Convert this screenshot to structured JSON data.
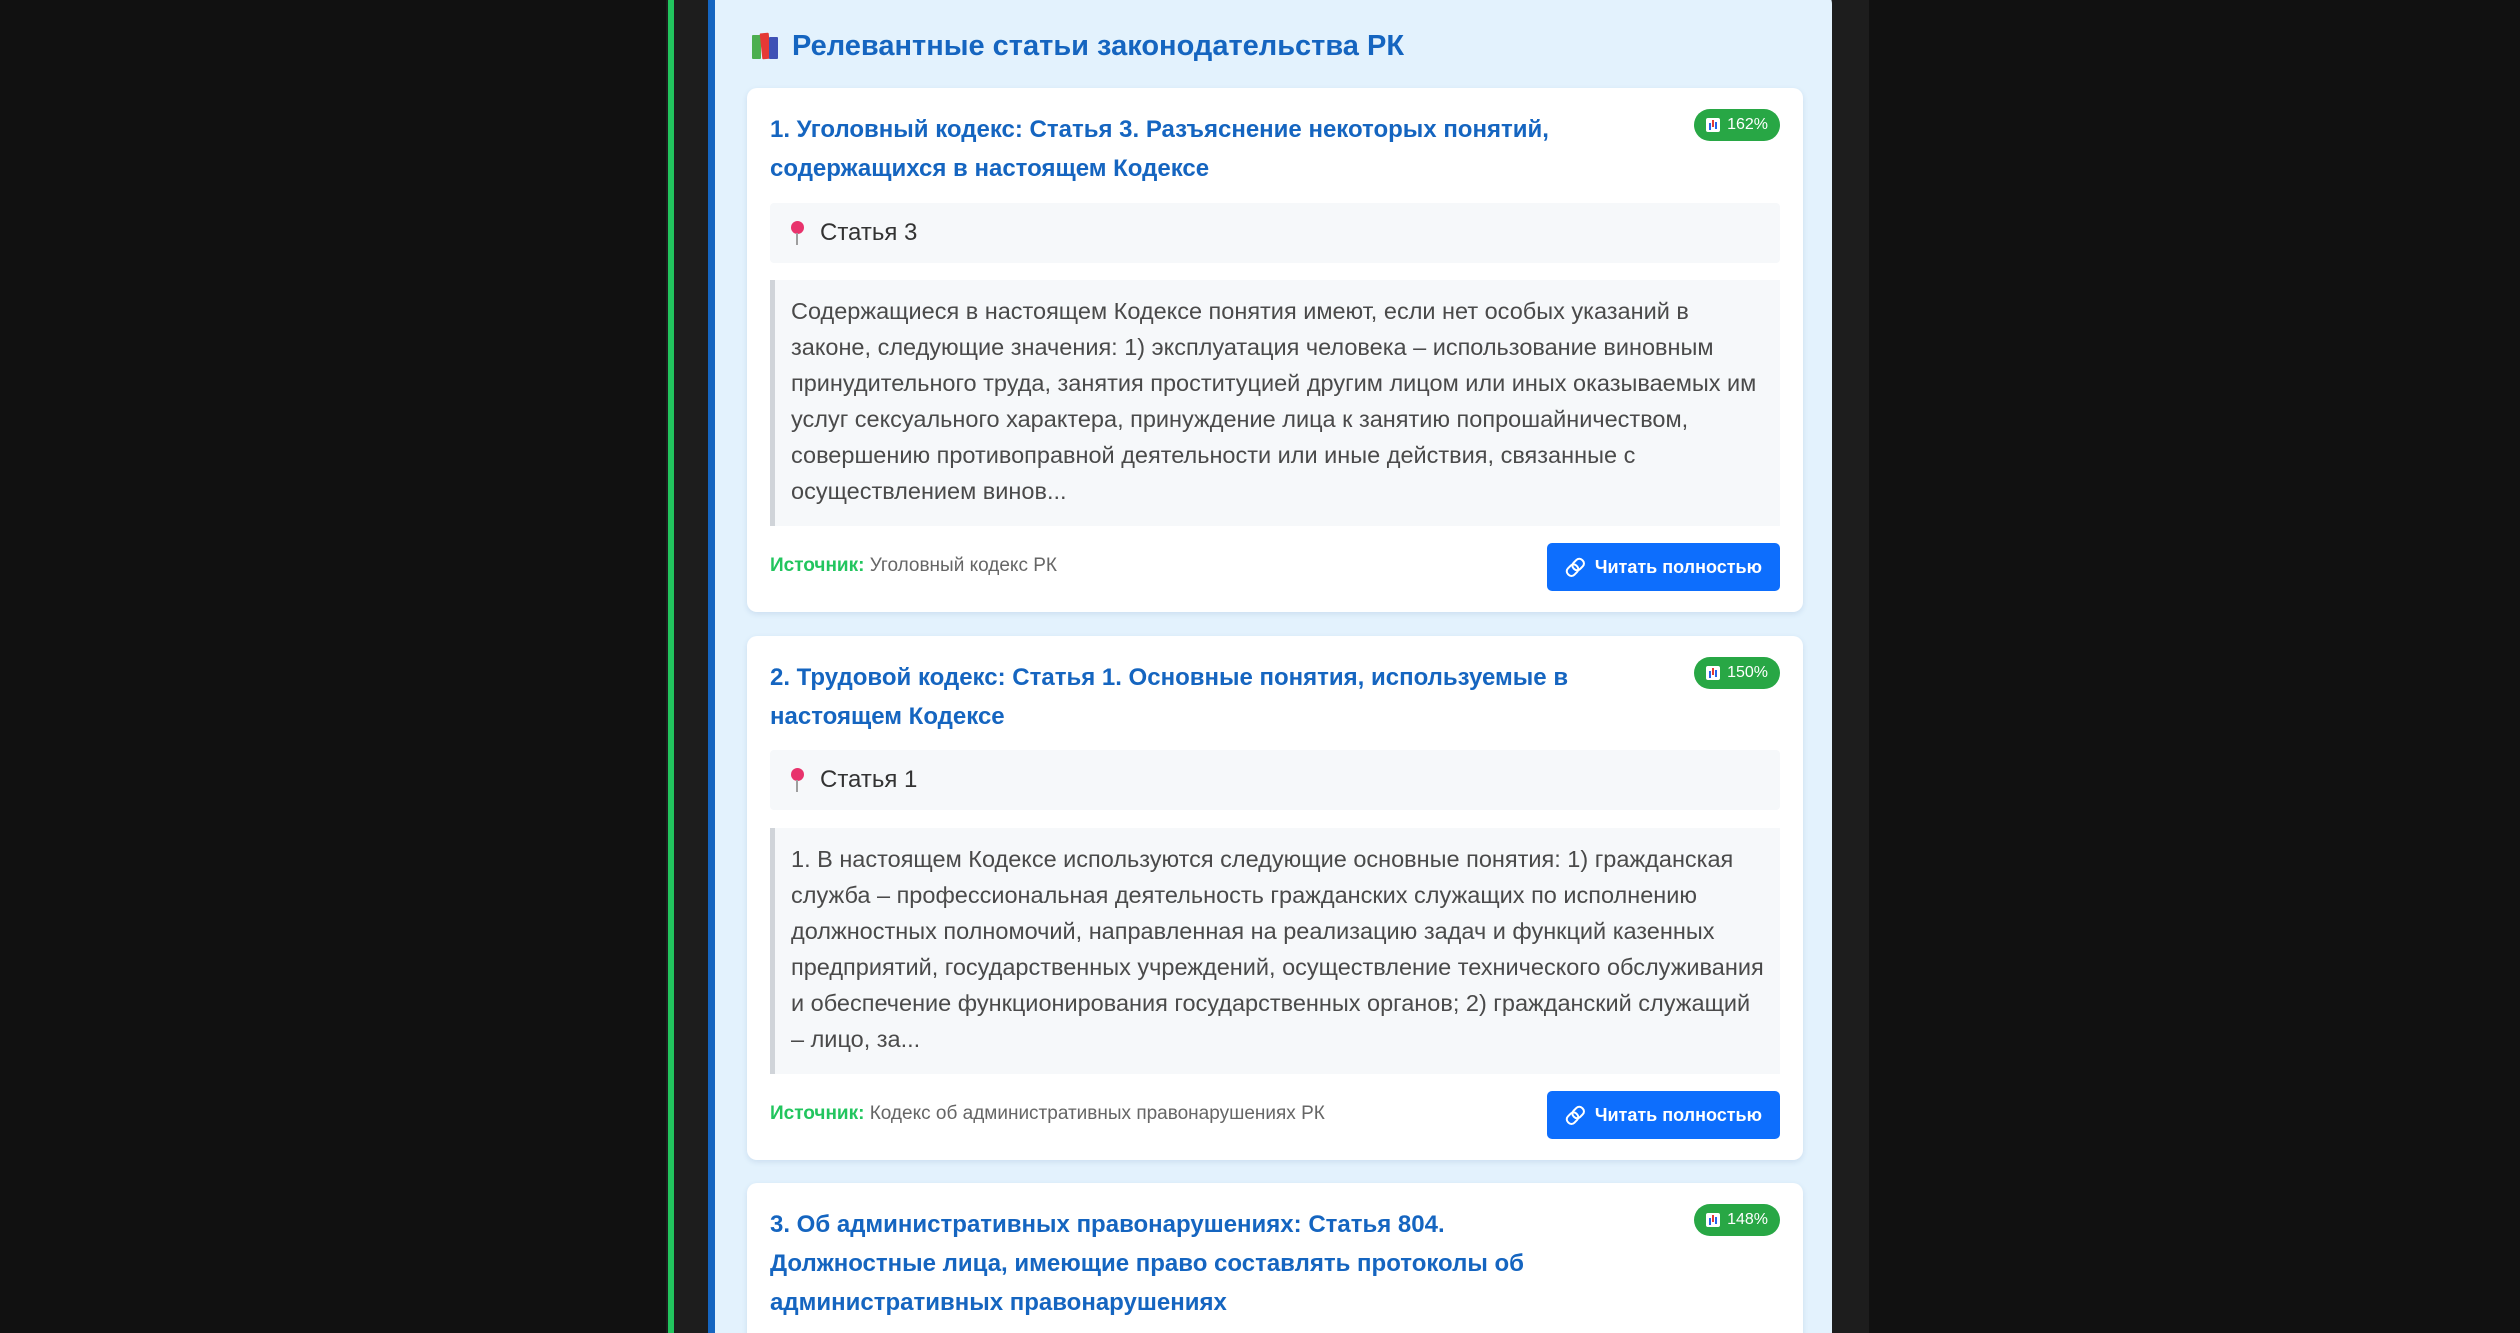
{
  "panel": {
    "title": "Релевантные статьи законодательства РК",
    "icon": "books-icon"
  },
  "articles": [
    {
      "title": "1. Уголовный кодекс: Статья 3. Разъяснение некоторых понятий, содержащихся в настоящем Кодексе",
      "score": "162%",
      "article_label": "Статья 3",
      "excerpt": "Содержащиеся в настоящем Кодексе понятия имеют, если нет особых указаний в законе, следующие значения: 1) эксплуатация человека – использование виновным принудительного труда, занятия проституцией другим лицом или иных оказываемых им услуг сексуального характера, принуждение лица к занятию попрошайничеством, совершению противоправной деятельности или иные действия, связанные с осуществлением винов...",
      "source_label": "Источник:",
      "source_value": "Уголовный кодекс РК",
      "button_label": "Читать полностью"
    },
    {
      "title": "2. Трудовой кодекс: Статья 1. Основные понятия, используемые в настоящем Кодексе",
      "score": "150%",
      "article_label": "Статья 1",
      "excerpt": "1. В настоящем Кодексе используются следующие основные понятия: 1) гражданская служба – профессиональная деятельность гражданских служащих по исполнению должностных полномочий, направленная на реализацию задач и функций казенных предприятий, государственных учреждений, осуществление технического обслуживания и обеспечение функционирования государственных органов; 2) гражданский служащий – лицо, за...",
      "source_label": "Источник:",
      "source_value": "Кодекс об административных правонарушениях РК",
      "button_label": "Читать полностью"
    },
    {
      "title": "3. Об административных правонарушениях: Статья 804. Должностные лица, имеющие право составлять протоколы об административных правонарушениях",
      "score": "148%"
    }
  ],
  "colors": {
    "page_background": "#111111",
    "panel_background": "#e3f2fd",
    "accent_blue": "#1565c0",
    "left_green_bar": "#22c55e",
    "badge_green": "#28a745",
    "button_blue": "#0d6efd",
    "source_label_green": "#22c55e"
  },
  "icons": {
    "score": "bar-chart-icon",
    "article": "pin-icon",
    "button": "link-icon"
  }
}
